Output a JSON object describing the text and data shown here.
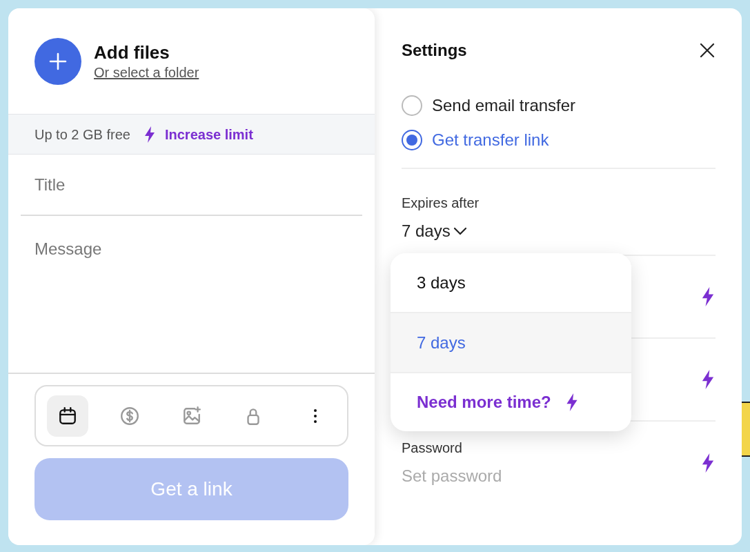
{
  "upload": {
    "title": "Add files",
    "folder_link": "Or select a folder"
  },
  "limit": {
    "text": "Up to 2 GB free",
    "link": "Increase limit"
  },
  "form": {
    "title_placeholder": "Title",
    "message_placeholder": "Message"
  },
  "toolbar": [
    {
      "kind": "calendar",
      "selected": true
    },
    {
      "kind": "dollar",
      "selected": false
    },
    {
      "kind": "image",
      "selected": false
    },
    {
      "kind": "lock",
      "selected": false
    },
    {
      "kind": "more",
      "selected": false
    }
  ],
  "submit": {
    "label": "Get a link",
    "disabled": true
  },
  "settings": {
    "title": "Settings",
    "modes": [
      {
        "label": "Send email transfer",
        "selected": false
      },
      {
        "label": "Get transfer link",
        "selected": true
      }
    ],
    "expiry": {
      "label": "Expires after",
      "value": "7 days",
      "expanded": true,
      "options": [
        {
          "label": "3 days",
          "selected": false
        },
        {
          "label": "7 days",
          "selected": true
        }
      ],
      "upsell": "Need more time?"
    },
    "rows": [
      {
        "premium": true
      },
      {
        "premium": true
      },
      {
        "label": "Password",
        "placeholder": "Set password",
        "premium": true
      }
    ]
  }
}
